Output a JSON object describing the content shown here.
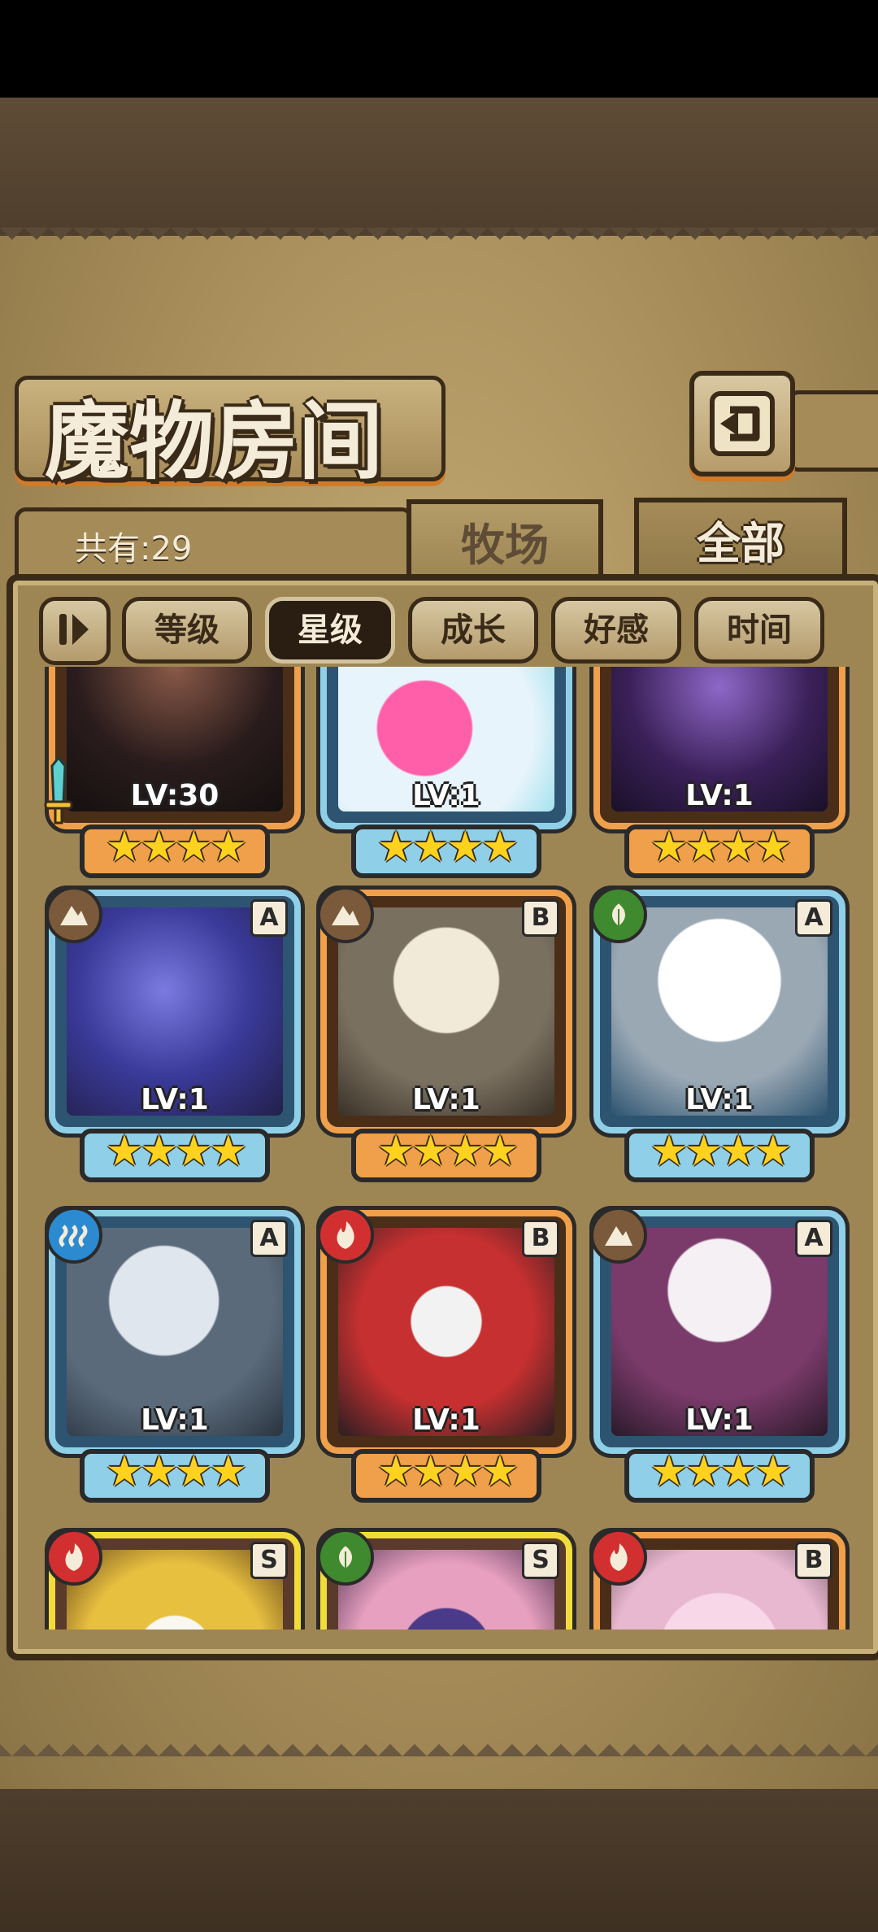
{
  "window": {
    "title": "魔物房间"
  },
  "header": {
    "back_icon": "return-icon"
  },
  "tabs": [
    {
      "label": "牧场",
      "active": false
    },
    {
      "label": "全部",
      "active": true
    }
  ],
  "summary": {
    "count_label": "共有:29"
  },
  "filters": {
    "sort_icon": "sort-order-icon",
    "buttons": [
      {
        "label": "等级",
        "active": false
      },
      {
        "label": "星级",
        "active": true
      },
      {
        "label": "成长",
        "active": false
      },
      {
        "label": "好感",
        "active": false
      },
      {
        "label": "时间",
        "active": false
      }
    ]
  },
  "monsters": [
    {
      "level": "LV:30",
      "stars": "★★★★",
      "frame": "orange",
      "rank": "",
      "element": "",
      "equipped_icon": "sword-icon"
    },
    {
      "level": "LV:1",
      "stars": "★★★★",
      "frame": "blue",
      "rank": "",
      "element": ""
    },
    {
      "level": "LV:1",
      "stars": "★★★★",
      "frame": "orange",
      "rank": "",
      "element": ""
    },
    {
      "level": "LV:1",
      "stars": "★★★★",
      "frame": "blue",
      "rank": "A",
      "element": "earth"
    },
    {
      "level": "LV:1",
      "stars": "★★★★",
      "frame": "orange",
      "rank": "B",
      "element": "earth"
    },
    {
      "level": "LV:1",
      "stars": "★★★★",
      "frame": "blue",
      "rank": "A",
      "element": "nature"
    },
    {
      "level": "LV:1",
      "stars": "★★★★",
      "frame": "blue",
      "rank": "A",
      "element": "water"
    },
    {
      "level": "LV:1",
      "stars": "★★★★",
      "frame": "orange",
      "rank": "B",
      "element": "fire"
    },
    {
      "level": "LV:1",
      "stars": "★★★★",
      "frame": "blue",
      "rank": "A",
      "element": "earth"
    },
    {
      "level": "",
      "stars": "",
      "frame": "yellow",
      "rank": "S",
      "element": "fire"
    },
    {
      "level": "",
      "stars": "",
      "frame": "yellow",
      "rank": "S",
      "element": "nature"
    },
    {
      "level": "",
      "stars": "",
      "frame": "orange",
      "rank": "B",
      "element": "fire"
    }
  ],
  "colors": {
    "parchment": "#a58b58",
    "dark_outline": "#3a2a18",
    "blue_frame": "#8fd0e8",
    "orange_frame": "#f0a04a",
    "yellow_frame": "#f1dc3a",
    "star": "#ffd21e"
  }
}
